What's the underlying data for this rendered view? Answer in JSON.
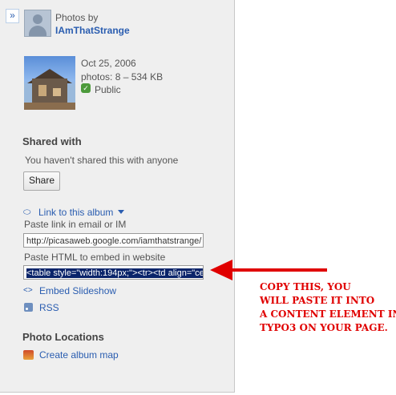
{
  "header": {
    "collapse_glyph": "»",
    "photos_by_label": "Photos by",
    "owner": "IAmThatStrange"
  },
  "album": {
    "date": "Oct 25, 2006",
    "photos_info": "photos: 8 – 534 KB",
    "visibility": "Public"
  },
  "shared": {
    "title": "Shared with",
    "status": "You haven't shared this with anyone",
    "share_button": "Share"
  },
  "links": {
    "link_to_album": "Link to this album",
    "email_label": "Paste link in email or IM",
    "url_value": "http://picasaweb.google.com/iamthatstrange/",
    "embed_label": "Paste HTML to embed in website",
    "embed_value": "<table style=\"width:194px;\"><tr><td align=\"cen",
    "embed_slideshow": "Embed Slideshow",
    "rss": "RSS"
  },
  "locations": {
    "title": "Photo Locations",
    "create_map": "Create album map"
  },
  "annotation": {
    "text": "COPY THIS, YOU\nWILL PASTE IT INTO\nA CONTENT ELEMENT IN\nTYPO3 ON YOUR PAGE.",
    "color": "#e00000"
  },
  "icons": [
    "expand-icon",
    "avatar",
    "public-icon",
    "link-icon",
    "chevron-down-icon",
    "slideshow-icon",
    "rss-icon",
    "map-icon",
    "arrow-icon"
  ]
}
